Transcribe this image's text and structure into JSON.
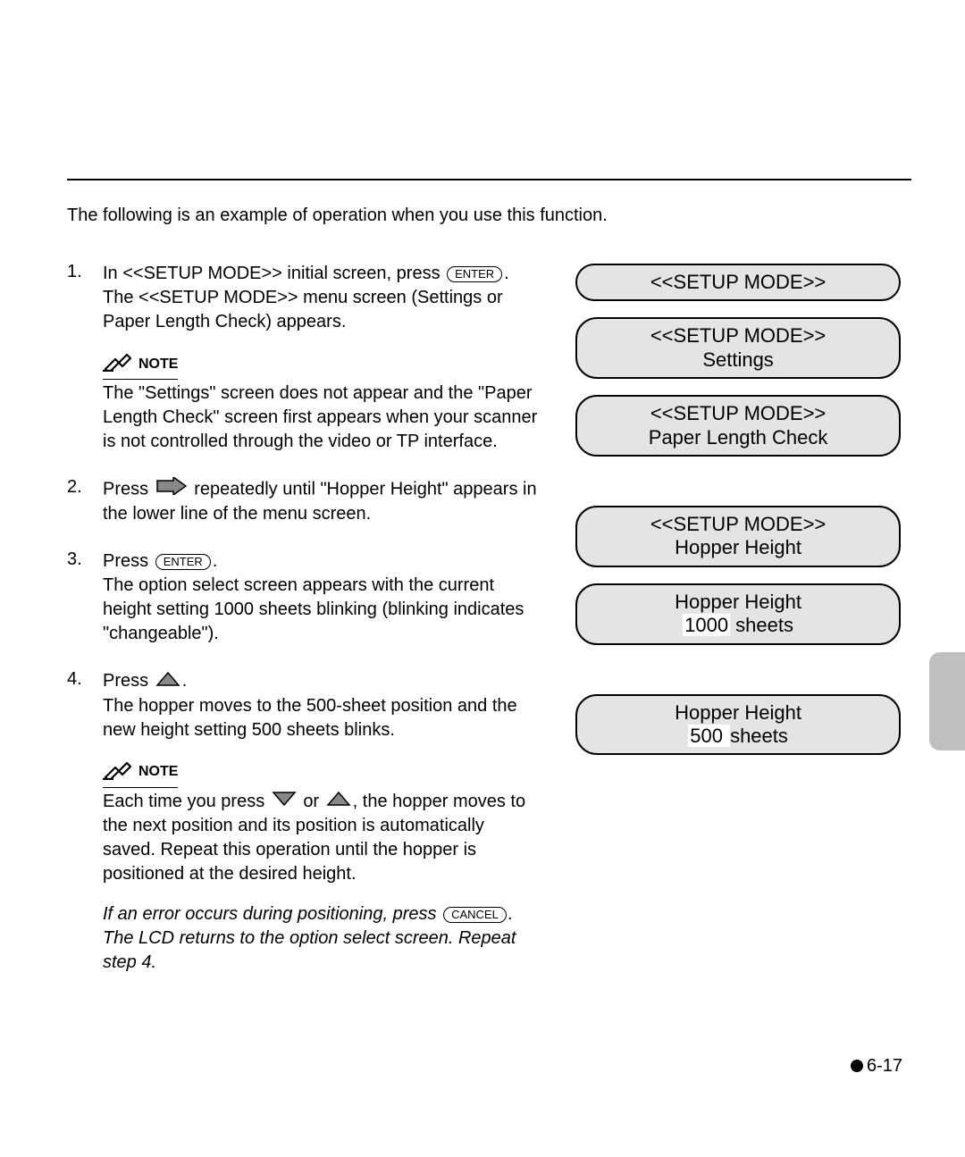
{
  "intro": "The following is an example of operation when you use this function.",
  "steps": [
    {
      "num": "1.",
      "pre": "In <<SETUP MODE>> initial screen, press ",
      "btn": "ENTER",
      "post": ".",
      "cont": "The <<SETUP MODE>> menu screen (Settings or Paper Length Check) appears.",
      "note_label": "NOTE",
      "note_text": "The \"Settings\" screen does not appear and the \"Paper Length Check\" screen first appears when your scanner is not controlled through the video or TP interface."
    },
    {
      "num": "2.",
      "pre": "Press ",
      "arrow": "right",
      "post": " repeatedly until \"Hopper Height\" appears in the lower line of the menu screen."
    },
    {
      "num": "3.",
      "pre": "Press ",
      "btn": "ENTER",
      "post": ".",
      "cont": "The option select screen appears with the current height setting 1000 sheets blinking (blinking indicates \"changeable\")."
    },
    {
      "num": "4.",
      "pre": "Press ",
      "arrow": "up",
      "post": ".",
      "cont": "The hopper moves to the 500-sheet position and the new height setting 500 sheets blinks.",
      "note_label": "NOTE",
      "note_pre": "Each time you press ",
      "note_mid": " or ",
      "note_post": ", the hopper moves to the next position and its position is automatically saved.  Repeat this operation until the hopper is positioned at the desired height.",
      "italic_pre": "If an error occurs during positioning, press ",
      "italic_btn": "CANCEL",
      "italic_post": ".  The LCD returns to the option select screen.  Repeat step 4."
    }
  ],
  "panels": {
    "group1": [
      {
        "lines": [
          "<<SETUP MODE>>"
        ],
        "highlight": false
      },
      {
        "lines": [
          "<<SETUP MODE>>",
          "Settings"
        ],
        "highlight": false
      },
      {
        "lines": [
          "<<SETUP MODE>>",
          "Paper Length Check"
        ],
        "highlight": false
      }
    ],
    "group2": [
      {
        "lines": [
          "<<SETUP MODE>>",
          "Hopper Height"
        ],
        "highlight": false
      },
      {
        "line1": "Hopper Height",
        "hl": "1000",
        "rest": " sheets"
      }
    ],
    "group3": [
      {
        "line1": "Hopper Height",
        "hl": " 500 ",
        "rest": "sheets"
      }
    ]
  },
  "footer": "6-17"
}
